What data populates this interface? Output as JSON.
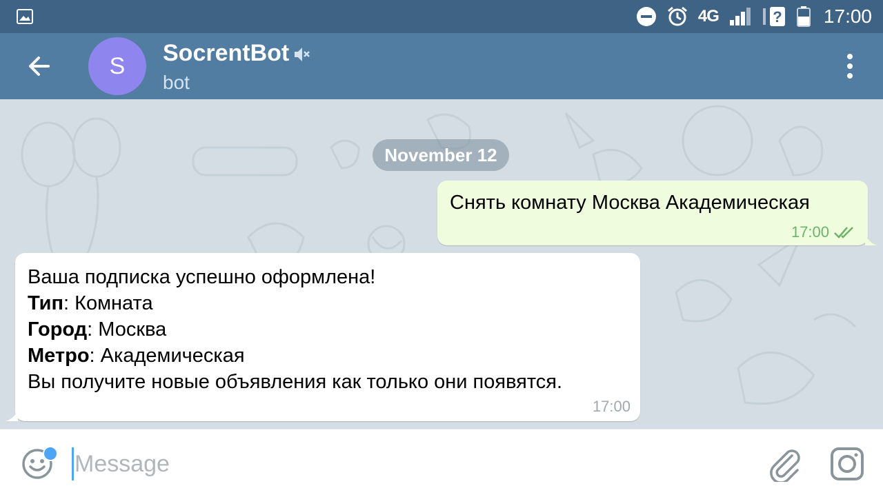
{
  "status_bar": {
    "time": "17:00",
    "network": "4G",
    "icons": [
      "gallery-icon",
      "dnd-icon",
      "alarm-icon",
      "signal-icon",
      "wifi-unknown-icon",
      "battery-icon"
    ]
  },
  "header": {
    "avatar_letter": "S",
    "title": "SocrentBot",
    "subtitle": "bot",
    "icons": [
      "back-arrow-icon",
      "mute-icon",
      "more-vert-icon"
    ]
  },
  "chat": {
    "date": "November 12",
    "messages": [
      {
        "direction": "outgoing",
        "text": "Снять комнату Москва Академическая",
        "time": "17:00",
        "status": "read"
      },
      {
        "direction": "incoming",
        "intro": "Ваша подписка успешно оформлена!",
        "fields": [
          {
            "label": "Тип",
            "value": ": Комната"
          },
          {
            "label": "Город",
            "value": ": Москва"
          },
          {
            "label": "Метро",
            "value": ": Академическая"
          }
        ],
        "outro": "Вы получите новые объявления как только они появятся.",
        "time": "17:00"
      }
    ]
  },
  "composer": {
    "placeholder": "Message",
    "value": "",
    "icons": [
      "emoji-icon",
      "attach-icon",
      "camera-icon"
    ]
  },
  "colors": {
    "status_bar": "#3f6385",
    "header": "#517da2",
    "avatar": "#8e85ee",
    "outgoing_bubble": "#effdde",
    "chat_bg": "#d4dde3",
    "accent": "#4ea4f6"
  }
}
